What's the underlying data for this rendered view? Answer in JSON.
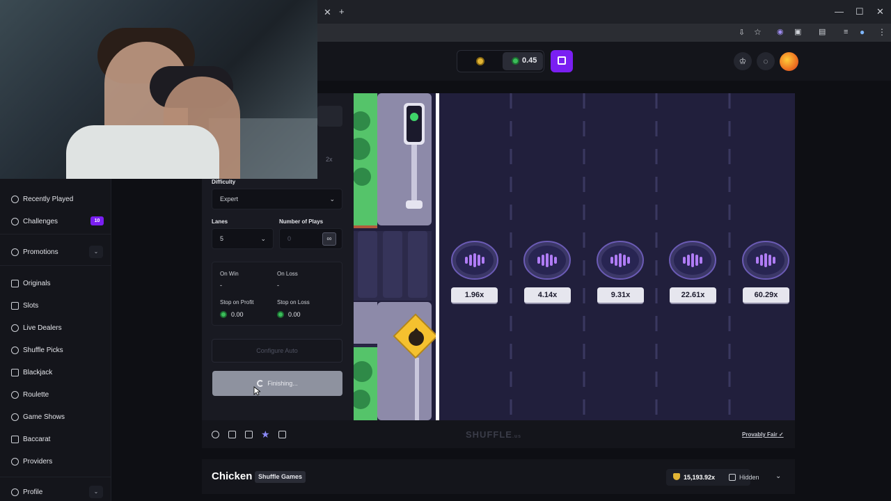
{
  "header": {
    "balance": "0.45"
  },
  "sidebar": {
    "items": [
      {
        "label": "Recently Played"
      },
      {
        "label": "Challenges",
        "badge": "10"
      },
      {
        "label": "Promotions"
      },
      {
        "label": "Originals"
      },
      {
        "label": "Slots"
      },
      {
        "label": "Live Dealers"
      },
      {
        "label": "Shuffle Picks"
      },
      {
        "label": "Blackjack"
      },
      {
        "label": "Roulette"
      },
      {
        "label": "Game Shows"
      },
      {
        "label": "Baccarat"
      },
      {
        "label": "Providers"
      },
      {
        "label": "Profile"
      }
    ]
  },
  "panel": {
    "multiplier_hint": "2x",
    "difficulty_label": "Difficulty",
    "difficulty_value": "Expert",
    "lanes_label": "Lanes",
    "lanes_value": "5",
    "plays_label": "Number of Plays",
    "plays_value": "0",
    "infinity_symbol": "∞",
    "on_win_label": "On Win",
    "on_win_value": "-",
    "on_loss_label": "On Loss",
    "on_loss_value": "-",
    "stop_profit_label": "Stop on Profit",
    "stop_profit_value": "0.00",
    "stop_loss_label": "Stop on Loss",
    "stop_loss_value": "0.00",
    "configure_auto": "Configure Auto",
    "finishing": "Finishing..."
  },
  "game": {
    "multipliers": [
      "1.96x",
      "4.14x",
      "9.31x",
      "22.61x",
      "60.29x"
    ]
  },
  "toolbar": {
    "logo_text": "SHUFFLE",
    "logo_suffix": ".us",
    "provably_fair": "Provably Fair"
  },
  "info": {
    "title": "Chicken",
    "provider": "Shuffle Games",
    "max_win": "15,193.92x",
    "visibility": "Hidden"
  },
  "colors": {
    "accent": "#7a1ff2",
    "game_bg": "#211f3c",
    "road": "#8b88a8",
    "grass": "#55c46a"
  }
}
